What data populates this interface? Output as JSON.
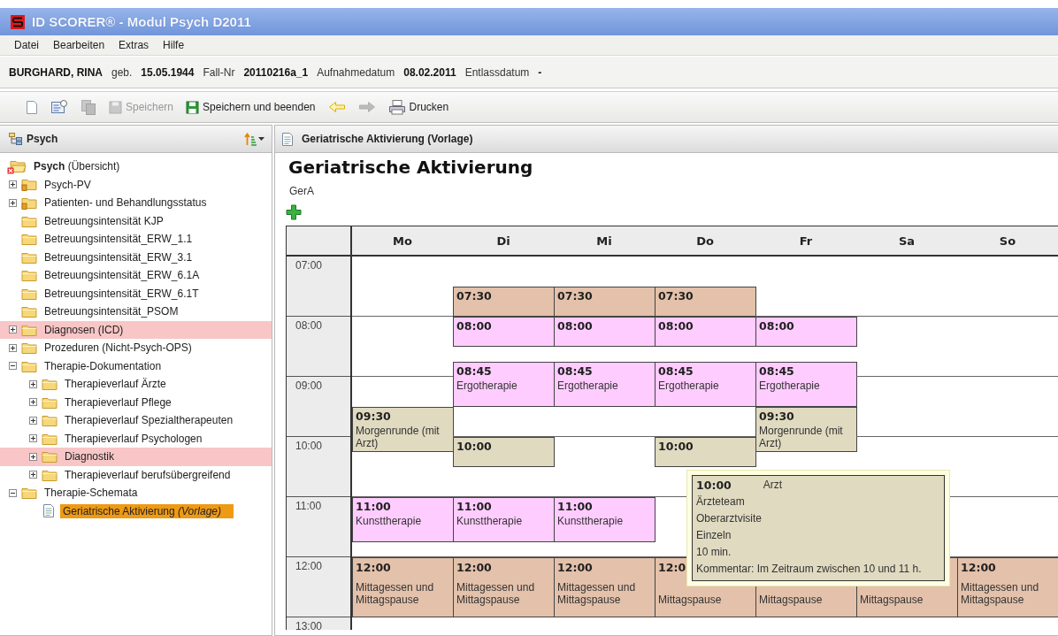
{
  "window": {
    "title": "ID SCORER® - Modul Psych D2011"
  },
  "menu": [
    "Datei",
    "Bearbeiten",
    "Extras",
    "Hilfe"
  ],
  "patient": {
    "name": "BURGHARD, RINA",
    "fields": [
      {
        "label": "geb.",
        "value": "15.05.1944"
      },
      {
        "label": "Fall-Nr",
        "value": "20110216a_1"
      },
      {
        "label": "Aufnahmedatum",
        "value": "08.02.2011"
      },
      {
        "label": "Entlassdatum",
        "value": "-"
      }
    ]
  },
  "toolbar": [
    {
      "kind": "new",
      "disabled": false
    },
    {
      "kind": "properties",
      "disabled": false
    },
    {
      "kind": "copy",
      "disabled": true
    },
    {
      "kind": "save",
      "label": "Speichern",
      "disabled": true
    },
    {
      "kind": "save-close",
      "label": "Speichern und beenden",
      "disabled": false
    },
    {
      "kind": "back",
      "disabled": false
    },
    {
      "kind": "forward",
      "disabled": true
    },
    {
      "kind": "print",
      "label": "Drucken",
      "disabled": false
    }
  ],
  "sidebar": {
    "title": "Psych",
    "tree": [
      {
        "label": "**Psych** (Übersicht)",
        "kind": "root",
        "expanded": true,
        "highlighted": false,
        "selected": false,
        "children": [
          {
            "label": "Psych-PV",
            "kind": "warning",
            "expanded": false,
            "highlighted": false,
            "selected": false
          },
          {
            "label": "Patienten- und Behandlungsstatus",
            "kind": "warning",
            "expanded": false,
            "highlighted": false,
            "selected": false
          },
          {
            "label": "Betreuungsintensität KJP",
            "kind": "folder",
            "highlighted": false,
            "selected": false
          },
          {
            "label": "Betreuungsintensität_ERW_1.1",
            "kind": "folder",
            "highlighted": false,
            "selected": false
          },
          {
            "label": "Betreuungsintensität_ERW_3.1",
            "kind": "folder",
            "highlighted": false,
            "selected": false
          },
          {
            "label": "Betreuungsintensität_ERW_6.1A",
            "kind": "folder",
            "highlighted": false,
            "selected": false
          },
          {
            "label": "Betreuungsintensität_ERW_6.1T",
            "kind": "folder",
            "highlighted": false,
            "selected": false
          },
          {
            "label": "Betreuungsintensität_PSOM",
            "kind": "folder",
            "highlighted": false,
            "selected": false
          },
          {
            "label": "Diagnosen (ICD)",
            "kind": "folder",
            "expanded": false,
            "highlighted": true,
            "selected": false
          },
          {
            "label": "Prozeduren (Nicht-Psych-OPS)",
            "kind": "folder",
            "expanded": false,
            "highlighted": false,
            "selected": false
          },
          {
            "label": "Therapie-Dokumentation",
            "kind": "folder",
            "expanded": true,
            "highlighted": false,
            "selected": false,
            "children": [
              {
                "label": "Therapieverlauf Ärzte",
                "kind": "folder",
                "expanded": false,
                "highlighted": false,
                "selected": false
              },
              {
                "label": "Therapieverlauf Pflege",
                "kind": "folder",
                "expanded": false,
                "highlighted": false,
                "selected": false
              },
              {
                "label": "Therapieverlauf Spezialtherapeuten",
                "kind": "folder",
                "expanded": false,
                "highlighted": false,
                "selected": false
              },
              {
                "label": "Therapieverlauf Psychologen",
                "kind": "folder",
                "expanded": false,
                "highlighted": false,
                "selected": false
              },
              {
                "label": "Diagnostik",
                "kind": "folder",
                "expanded": false,
                "highlighted": true,
                "selected": false
              },
              {
                "label": "Therapieverlauf berufsübergreifend",
                "kind": "folder",
                "expanded": false,
                "highlighted": false,
                "selected": false
              }
            ]
          },
          {
            "label": "Therapie-Schemata",
            "kind": "folder",
            "expanded": true,
            "highlighted": false,
            "selected": false,
            "children": [
              {
                "label": "Geriatrische Aktivierung *(Vorlage)*",
                "kind": "document",
                "highlighted": false,
                "selected": true
              }
            ]
          }
        ]
      }
    ]
  },
  "main": {
    "tab_title": "Geriatrische Aktivierung (Vorlage)",
    "heading": "Geriatrische Aktivierung",
    "code": "GerA",
    "calendar": {
      "hours": [
        "07:00",
        "08:00",
        "09:00",
        "10:00",
        "11:00",
        "12:00",
        "13:00"
      ],
      "days": [
        {
          "label": "Mo",
          "events": [
            {
              "kind": "long",
              "time": "09:30",
              "label": "Morgenrunde (mit Arzt)",
              "color": "#e0dac0"
            },
            {
              "kind": "long",
              "time": "11:00",
              "label": "Kunsttherapie",
              "color": "#ffccff"
            },
            {
              "kind": "hour",
              "time": "12:00",
              "label": "Mittagessen und Mittagspause",
              "color": "#e3c1aa"
            }
          ]
        },
        {
          "label": "Di",
          "events": [
            {
              "kind": "half",
              "time": "07:30",
              "color": "#e3c1aa"
            },
            {
              "kind": "half",
              "time": "08:00",
              "color": "#ffccff"
            },
            {
              "kind": "long",
              "time": "08:45",
              "label": "Ergotherapie",
              "color": "#ffccff"
            },
            {
              "kind": "half",
              "time": "10:00",
              "color": "#e0dac0"
            },
            {
              "kind": "long",
              "time": "11:00",
              "label": "Kunsttherapie",
              "color": "#ffccff"
            },
            {
              "kind": "hour",
              "time": "12:00",
              "label": "Mittagessen und Mittagspause",
              "color": "#e3c1aa"
            }
          ]
        },
        {
          "label": "Mi",
          "events": [
            {
              "kind": "half",
              "time": "07:30",
              "color": "#e3c1aa"
            },
            {
              "kind": "half",
              "time": "08:00",
              "color": "#ffccff"
            },
            {
              "kind": "long",
              "time": "08:45",
              "label": "Ergotherapie",
              "color": "#ffccff"
            },
            {
              "kind": "long",
              "time": "11:00",
              "label": "Kunsttherapie",
              "color": "#ffccff"
            },
            {
              "kind": "hour",
              "time": "12:00",
              "label": "Mittagessen und Mittagspause",
              "color": "#e3c1aa"
            }
          ]
        },
        {
          "label": "Do",
          "events": [
            {
              "kind": "half",
              "time": "07:30",
              "color": "#e3c1aa"
            },
            {
              "kind": "half",
              "time": "08:00",
              "color": "#ffccff"
            },
            {
              "kind": "long",
              "time": "08:45",
              "label": "Ergotherapie",
              "color": "#ffccff"
            },
            {
              "kind": "half",
              "time": "10:00",
              "color": "#e0dac0"
            },
            {
              "kind": "hour",
              "time": "12:0",
              "label": "Mittagspause",
              "color": "#e3c1aa"
            }
          ]
        },
        {
          "label": "Fr",
          "events": [
            {
              "kind": "half",
              "time": "08:00",
              "color": "#ffccff"
            },
            {
              "kind": "long",
              "time": "08:45",
              "label": "Ergotherapie",
              "color": "#ffccff"
            },
            {
              "kind": "long",
              "time": "09:30",
              "label": "Morgenrunde (mit Arzt)",
              "color": "#e0dac0"
            },
            {
              "kind": "hour",
              "label": "Mittagspause",
              "color": "#e3c1aa"
            }
          ]
        },
        {
          "label": "Sa",
          "events": [
            {
              "kind": "hour",
              "label": "Mittagspause",
              "color": "#e3c1aa"
            }
          ]
        },
        {
          "label": "So",
          "events": [
            {
              "kind": "hour",
              "time": "12:00",
              "label": "Mittagessen und Mittagspause",
              "color": "#e3c1aa"
            }
          ]
        }
      ],
      "tooltip": {
        "time": "10:00",
        "role": "Arzt",
        "lines": [
          "Ärzteteam",
          "Oberarztvisite",
          "Einzeln",
          "10 min.",
          "Kommentar: Im Zeitraum zwischen 10 und 11 h."
        ]
      }
    }
  }
}
